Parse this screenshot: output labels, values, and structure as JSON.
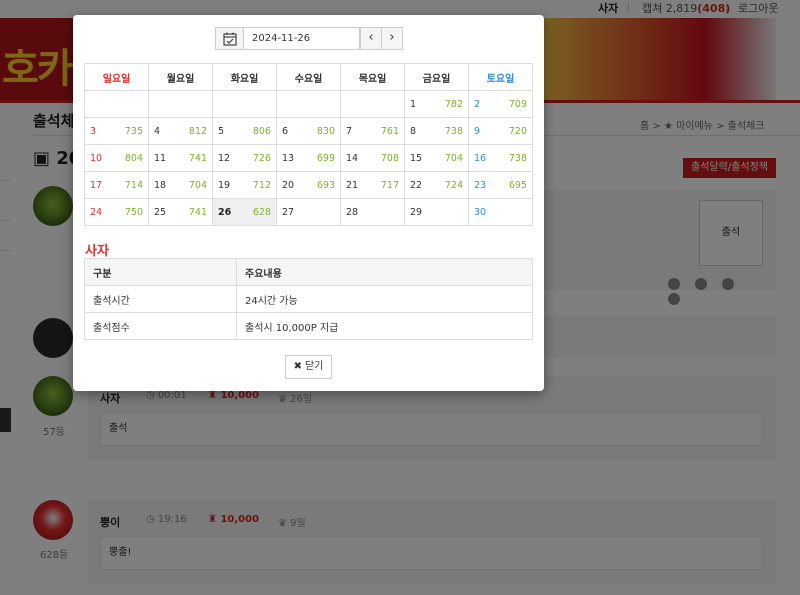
{
  "topbar": {
    "user": "사자",
    "points_label": "캡쳐 2,819",
    "points_badge": "(408)",
    "logout": "로그아웃"
  },
  "banner": {
    "logo_text": "호카"
  },
  "page": {
    "heading": "출석체크",
    "breadcrumb": "홈 > ★ 마이메뉴 > 출석체크",
    "subtitle": "20",
    "calendar_button": "출석달력/출석정책",
    "attend_button": "출석"
  },
  "posts": [
    {
      "name": "사자",
      "time": "00:01",
      "points": "10,000",
      "days": "26일",
      "body": "출석",
      "rank": "57등"
    },
    {
      "name": "뿡이",
      "time": "19:16",
      "points": "10,000",
      "days": "9일",
      "body": "뿡출!",
      "rank": "628등"
    }
  ],
  "modal": {
    "date": "2024-11-26",
    "prev": "‹",
    "next": "›",
    "weekdays": [
      "일요일",
      "월요일",
      "화요일",
      "수요일",
      "목요일",
      "금요일",
      "토요일"
    ],
    "weeks": [
      [
        [
          "",
          ""
        ],
        [
          "",
          ""
        ],
        [
          "",
          ""
        ],
        [
          "",
          ""
        ],
        [
          "",
          ""
        ],
        [
          "1",
          "782"
        ],
        [
          "2",
          "709"
        ]
      ],
      [
        [
          "3",
          "735"
        ],
        [
          "4",
          "812"
        ],
        [
          "5",
          "806"
        ],
        [
          "6",
          "830"
        ],
        [
          "7",
          "761"
        ],
        [
          "8",
          "738"
        ],
        [
          "9",
          "720"
        ]
      ],
      [
        [
          "10",
          "804"
        ],
        [
          "11",
          "741"
        ],
        [
          "12",
          "726"
        ],
        [
          "13",
          "699"
        ],
        [
          "14",
          "708"
        ],
        [
          "15",
          "704"
        ],
        [
          "16",
          "738"
        ]
      ],
      [
        [
          "17",
          "714"
        ],
        [
          "18",
          "704"
        ],
        [
          "19",
          "712"
        ],
        [
          "20",
          "693"
        ],
        [
          "21",
          "717"
        ],
        [
          "22",
          "724"
        ],
        [
          "23",
          "695"
        ]
      ],
      [
        [
          "24",
          "750"
        ],
        [
          "25",
          "741"
        ],
        [
          "26",
          "628"
        ],
        [
          "27",
          ""
        ],
        [
          "28",
          ""
        ],
        [
          "29",
          ""
        ],
        [
          "30",
          ""
        ]
      ]
    ],
    "today": "26",
    "section_title": "사자",
    "info_headers": [
      "구분",
      "주요내용"
    ],
    "info_rows": [
      [
        "출석시간",
        "24시간 가능"
      ],
      [
        "출석점수",
        "출석시 10,000P 지급"
      ]
    ],
    "close_label": "닫기"
  },
  "colors": {
    "accent_red": "#c81c1c",
    "sunday": "#e0312a",
    "saturday": "#2f8fd6",
    "count_green": "#7cb32a"
  }
}
